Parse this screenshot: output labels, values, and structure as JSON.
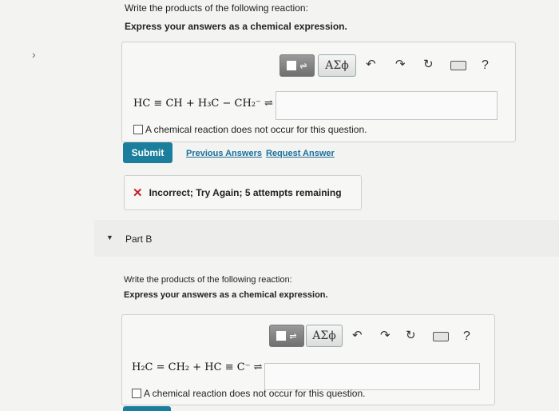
{
  "part_a": {
    "instruction": "Write the products of the following reaction:",
    "express": "Express your answers as a chemical expression.",
    "equation": "HC ≡ CH + H₃C − CH₂⁻ ⇌",
    "no_reaction_label": "A chemical reaction does not occur for this question.",
    "submit_label": "Submit",
    "previous_answers_label": "Previous Answers",
    "request_answer_label": "Request Answer",
    "feedback_text": "Incorrect; Try Again; 5 attempts remaining",
    "feedback_icon": "✕"
  },
  "toolbar": {
    "templates_icon": "templates-icon",
    "symbols_label": "ΑΣϕ",
    "undo_icon": "↶",
    "redo_icon": "↷",
    "reset_icon": "↻",
    "keyboard_icon": "keyboard-icon",
    "help_label": "?"
  },
  "part_b": {
    "title": "Part B",
    "instruction": "Write the products of the following reaction:",
    "express": "Express your answers as a chemical expression.",
    "equation": "H₂C = CH₂ + HC ≡ C⁻ ⇌",
    "no_reaction_label": "A chemical reaction does not occur for this question."
  },
  "nav": {
    "expand_icon": "›",
    "collapse_icon": "▼"
  },
  "colors": {
    "submit": "#1a7e9c",
    "link": "#1a6f9c",
    "error": "#c8202a"
  }
}
